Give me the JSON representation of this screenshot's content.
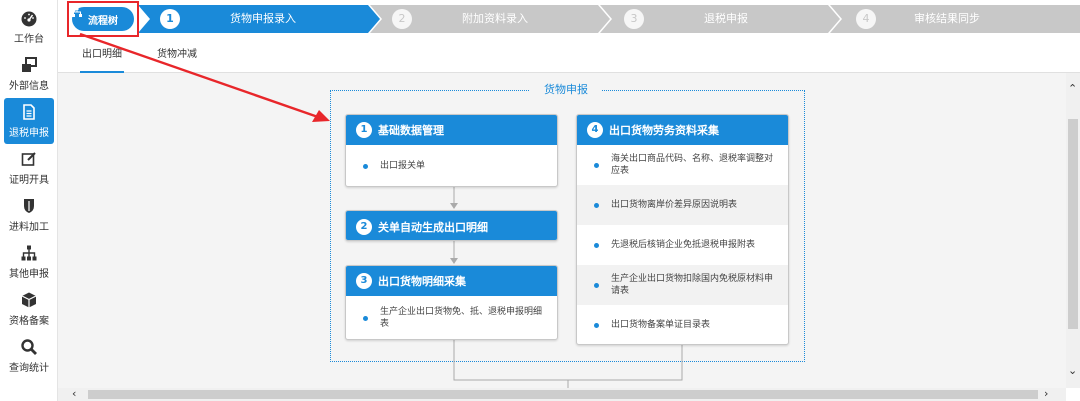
{
  "sidebar": {
    "items": [
      {
        "label": "工作台",
        "icon": "dashboard-icon"
      },
      {
        "label": "外部信息",
        "icon": "windows-icon"
      },
      {
        "label": "退税申报",
        "icon": "document-icon"
      },
      {
        "label": "证明开具",
        "icon": "edit-icon"
      },
      {
        "label": "进料加工",
        "icon": "shield-icon"
      },
      {
        "label": "其他申报",
        "icon": "hierarchy-icon"
      },
      {
        "label": "资格备案",
        "icon": "cube-icon"
      },
      {
        "label": "查询统计",
        "icon": "search-icon"
      }
    ],
    "active_index": 2
  },
  "stepbar": {
    "flow_tree_label": "流程树",
    "steps": [
      {
        "num": "1",
        "label": "货物申报录入"
      },
      {
        "num": "2",
        "label": "附加资料录入"
      },
      {
        "num": "3",
        "label": "退税申报"
      },
      {
        "num": "4",
        "label": "审核结果同步"
      }
    ],
    "active_step": 1
  },
  "tabs": [
    {
      "label": "出口明细"
    },
    {
      "label": "货物冲减"
    }
  ],
  "flow": {
    "title": "货物申报",
    "cards": {
      "c1": {
        "num": "1",
        "title": "基础数据管理",
        "items": [
          "出口报关单"
        ]
      },
      "c2": {
        "num": "2",
        "title": "关单自动生成出口明细"
      },
      "c3": {
        "num": "3",
        "title": "出口货物明细采集",
        "items": [
          "生产企业出口货物免、抵、退税申报明细表"
        ]
      },
      "c4": {
        "num": "4",
        "title": "出口货物劳务资料采集",
        "items": [
          "海关出口商品代码、名称、退税率调整对应表",
          "出口货物离岸价差异原因说明表",
          "先退税后核销企业免抵退税申报附表",
          "生产企业出口货物扣除国内免税原材料申请表",
          "出口货物备案单证目录表"
        ]
      }
    }
  },
  "colors": {
    "accent": "#1a8ad9",
    "step_inactive": "#c8c8c8",
    "highlight": "#e8262a"
  }
}
